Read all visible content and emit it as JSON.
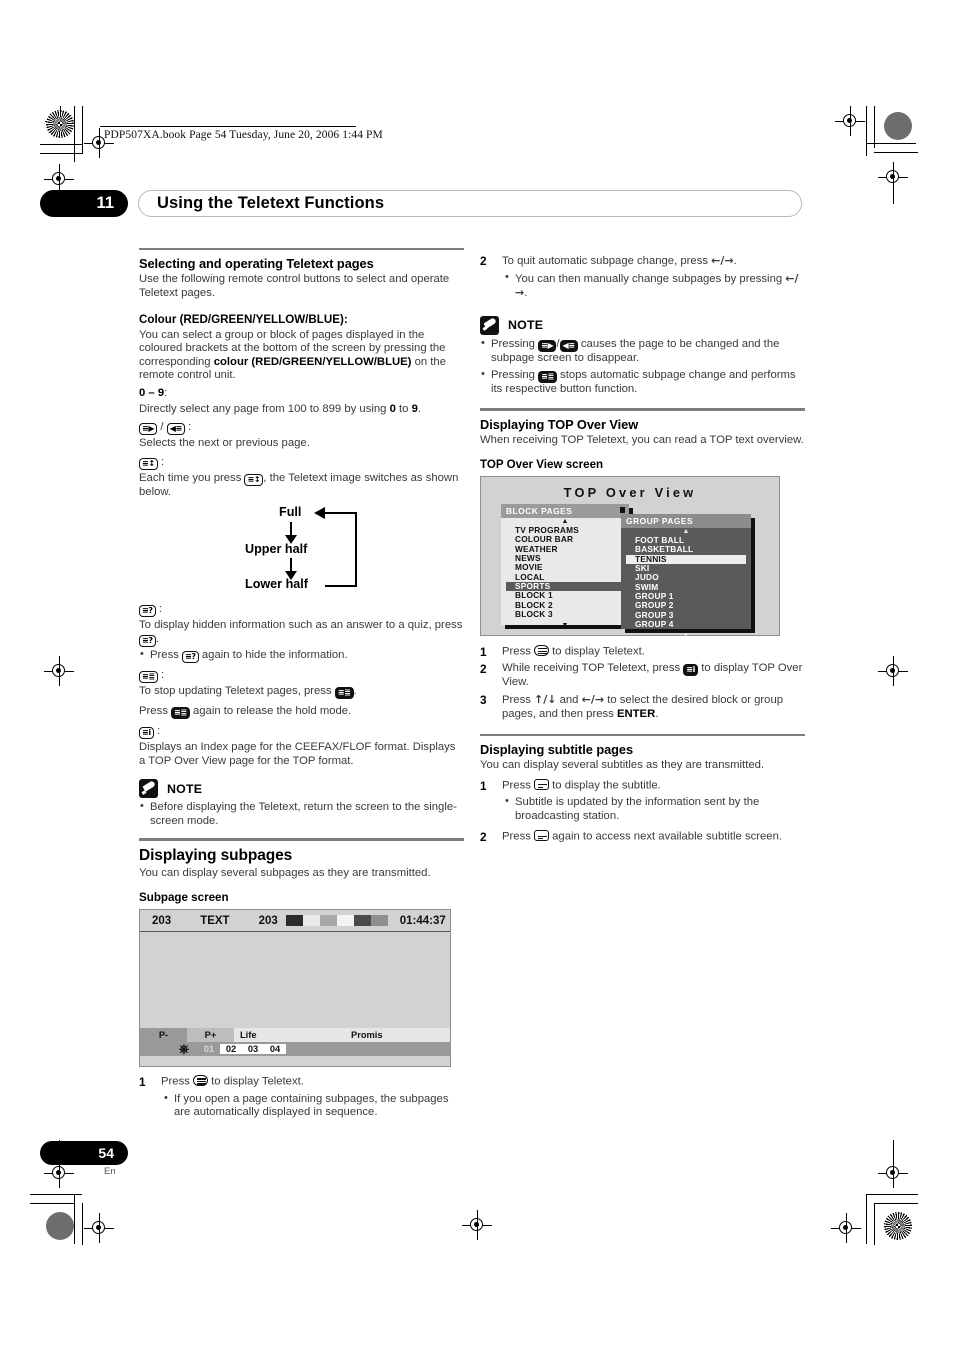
{
  "header": {
    "book_line": "PDP507XA.book  Page 54  Tuesday, June 20, 2006  1:44 PM",
    "chapter_number": "11",
    "chapter_title": "Using the Teletext Functions"
  },
  "footer": {
    "page_number": "54",
    "language": "En"
  },
  "left_column": {
    "section1": {
      "heading": "Selecting and operating Teletext pages",
      "intro": "Use the following remote control buttons to select and operate Teletext pages.",
      "colour_heading": "Colour (RED/GREEN/YELLOW/BLUE):",
      "colour_body_1": "You can select a group or block of pages displayed in the coloured brackets at the bottom of the screen by pressing the corresponding ",
      "colour_body_bold": "colour (RED/GREEN/YELLOW/BLUE)",
      "colour_body_2": " on the remote control unit.",
      "range_heading": "0 – 9",
      "range_heading_colon": ":",
      "range_body_1": "Directly select any page from 100 to 899 by using ",
      "range_body_b1": "0",
      "range_body_2": " to ",
      "range_body_b2": "9",
      "range_body_3": ".",
      "nextprev_label": ":",
      "nextprev_body": "Selects the next or previous page.",
      "size_label": ":",
      "size_body_1": "Each time you press ",
      "size_body_2": ", the Teletext image switches as shown below."
    },
    "switch_diagram": {
      "full": "Full",
      "upper": "Upper half",
      "lower": "Lower half"
    },
    "reveal": {
      "label": ":",
      "body_1": "To display hidden information such as an answer to a quiz, press ",
      "body_2": ".",
      "bullet_1": "Press ",
      "bullet_2": " again to hide the information."
    },
    "hold": {
      "label": ":",
      "body_1": "To stop updating Teletext pages, press ",
      "body_2": ".",
      "body_3a": "Press ",
      "body_3b": " again to release the hold mode."
    },
    "index": {
      "label": ":",
      "body": "Displays an Index page for the CEEFAX/FLOF format. Displays a TOP Over View page for the TOP format."
    },
    "note": {
      "title": "NOTE",
      "bullets": [
        "Before displaying the Teletext, return the screen to the single-screen mode."
      ]
    },
    "subpages": {
      "heading": "Displaying subpages",
      "intro": "You can display several subpages as they are transmitted.",
      "screen_label": "Subpage screen",
      "screen": {
        "page_left": "203",
        "text_label": "TEXT",
        "page_right": "203",
        "clock": "01:44:37",
        "swatch_colors": [
          "#2b2b2b",
          "#e9e9e9",
          "#a8a8a8",
          "#f4f4f4",
          "#4a4a4a",
          "#8f8f8f"
        ],
        "bar_prev": "P-",
        "bar_next": "P+",
        "bar_life": "Life",
        "bar_promis": "Promis",
        "subpage_numbers": [
          "01",
          "02",
          "03",
          "04"
        ],
        "active_subpage_index": 1,
        "swirl_icon": "swirl-icon"
      },
      "steps": [
        {
          "num": "1",
          "text_1": "Press ",
          "text_2": " to display Teletext.",
          "bullets": [
            "If you open a page containing subpages, the subpages are automatically displayed in sequence."
          ]
        }
      ]
    }
  },
  "right_column": {
    "step2": {
      "num": "2",
      "text_1": "To quit automatic subpage change, press ",
      "arrows": "←/→",
      "text_2": ".",
      "bullet_1": "You can then manually change subpages by pressing ",
      "bullet_arrows": "←/→",
      "bullet_2": "."
    },
    "note": {
      "title": "NOTE",
      "bullet1_a": "Pressing ",
      "bullet1_b": "/",
      "bullet1_c": " causes the page to be changed and the subpage screen to disappear.",
      "bullet2_a": "Pressing ",
      "bullet2_b": " stops automatic subpage change and performs its respective button function."
    },
    "topview": {
      "heading": "Displaying TOP Over View",
      "intro": "When receiving TOP Teletext, you can read a TOP text overview.",
      "screen_label": "TOP Over View screen",
      "screen": {
        "title": "TOP Over View",
        "block_panel": {
          "caption": "BLOCK PAGES",
          "up_arrow": "▲",
          "down_arrow": "▼",
          "items": [
            "TV PROGRAMS",
            "COLOUR BAR",
            "WEATHER",
            "NEWS",
            "MOVIE",
            "LOCAL",
            "SPORTS",
            "BLOCK 1",
            "BLOCK 2",
            "BLOCK 3"
          ],
          "selected": "SPORTS"
        },
        "group_panel": {
          "caption": "GROUP PAGES",
          "up_arrow": "▲",
          "down_arrow": "▼",
          "items": [
            "FOOT BALL",
            "BASKETBALL",
            "TENNIS",
            "SKI",
            "JUDO",
            "SWIM",
            "GROUP 1",
            "GROUP 2",
            "GROUP 3",
            "GROUP 4"
          ],
          "selected": "TENNIS"
        }
      },
      "steps": [
        {
          "num": "1",
          "text_1": "Press ",
          "text_2": " to display Teletext."
        },
        {
          "num": "2",
          "text_1": "While receiving TOP Teletext, press ",
          "text_2": " to display TOP Over View."
        },
        {
          "num": "3",
          "text_1": "Press ",
          "arrows_1": "↑/↓",
          "text_2": " and ",
          "arrows_2": "←/→",
          "text_3": " to select the desired block or group pages, and then press ",
          "enter": "ENTER",
          "text_4": "."
        }
      ]
    },
    "subtitle": {
      "heading": "Displaying subtitle pages",
      "intro": "You can display several subtitles as they are transmitted.",
      "steps": [
        {
          "num": "1",
          "text_1": "Press ",
          "text_2": " to display the subtitle.",
          "bullets": [
            "Subtitle is updated by the information sent by the broadcasting station."
          ]
        },
        {
          "num": "2",
          "text_1": "Press ",
          "text_2": " again to access next available subtitle screen."
        }
      ]
    }
  },
  "icons": {
    "next_page": "teletext-next-page-icon",
    "prev_page": "teletext-prev-page-icon",
    "size": "teletext-size-icon",
    "reveal": "teletext-reveal-icon",
    "hold": "teletext-hold-icon",
    "index": "teletext-index-icon",
    "teletext": "teletext-icon",
    "subtitle": "subtitle-icon"
  }
}
